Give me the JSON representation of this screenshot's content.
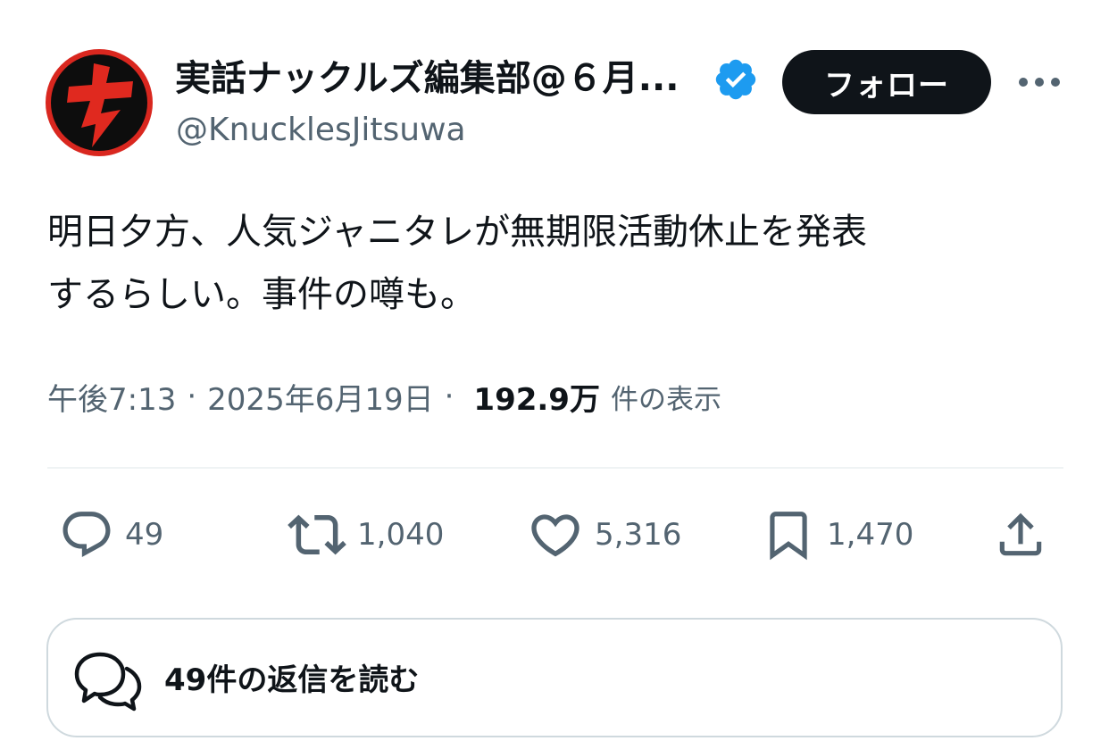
{
  "author": {
    "display_name": "実話ナックルズ編集部@６月...",
    "handle": "@KnucklesJitsuwa",
    "verified": true,
    "avatar_glyph": "ナ"
  },
  "follow_label": "フォロー",
  "more_icon": "more-horizontal-icon",
  "tweet": {
    "line1": "明日夕方、人気ジャニタレが無期限活動休止を発表",
    "line2": "するらしい。事件の噂も。"
  },
  "meta": {
    "time": "午後7:13",
    "separator1": "·",
    "date": "2025年6月19日",
    "separator2": "·",
    "views": "192.9万",
    "views_label": "件の表示"
  },
  "actions": {
    "replies": "49",
    "retweets": "1,040",
    "likes": "5,316",
    "bookmarks": "1,470"
  },
  "read_replies_label": "49件の返信を読む",
  "colors": {
    "text": "#0f1419",
    "secondary": "#536471",
    "verified_blue": "#1d9bf0",
    "avatar_red": "#d9271f",
    "button_dark": "#0f1419"
  }
}
